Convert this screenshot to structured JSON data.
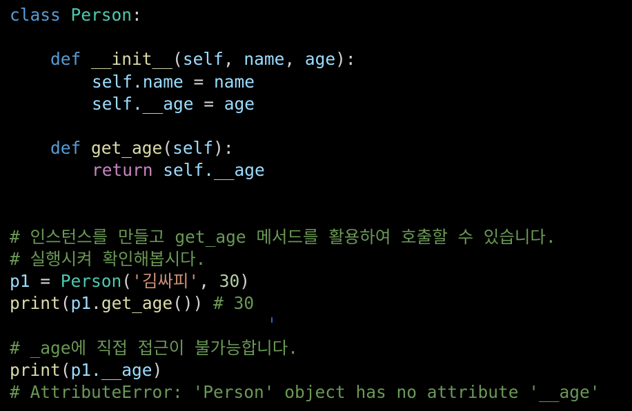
{
  "code": {
    "l1": {
      "kw": "class",
      "name": "Person",
      "colon": ":"
    },
    "l3": {
      "kw": "def",
      "fn": "__init__",
      "open": "(",
      "p1": "self",
      "c1": ", ",
      "p2": "name",
      "c2": ", ",
      "p3": "age",
      "close": "):"
    },
    "l4": {
      "self": "self",
      "attr": ".name",
      "eq": " = ",
      "val": "name"
    },
    "l5": {
      "self": "self",
      "attr": ".__age",
      "eq": " = ",
      "val": "age"
    },
    "l7": {
      "kw": "def",
      "fn": "get_age",
      "open": "(",
      "p1": "self",
      "close": "):"
    },
    "l8": {
      "kw": "return",
      "self": "self",
      "attr": ".__age"
    },
    "c1": "# 인스턴스를 만들고 get_age 메서드를 활용하여 호출할 수 있습니다.",
    "c2": "# 실행시켜 확인해봅시다.",
    "l12": {
      "var": "p1",
      "eq": " = ",
      "cls": "Person",
      "open": "(",
      "str": "'김싸피'",
      "sep": ", ",
      "num": "30",
      "close": ")"
    },
    "l13": {
      "fn": "print",
      "open": "(",
      "var": "p1",
      "dot": ".",
      "method": "get_age",
      "close": "())",
      "comment": " # 30"
    },
    "c3": "# _age에 직접 접근이 불가능합니다.",
    "l16": {
      "fn": "print",
      "open": "(",
      "var": "p1",
      "attr": ".__age",
      "close": ")"
    },
    "c4": "# AttributeError: 'Person' object has no attribute '__age'"
  }
}
